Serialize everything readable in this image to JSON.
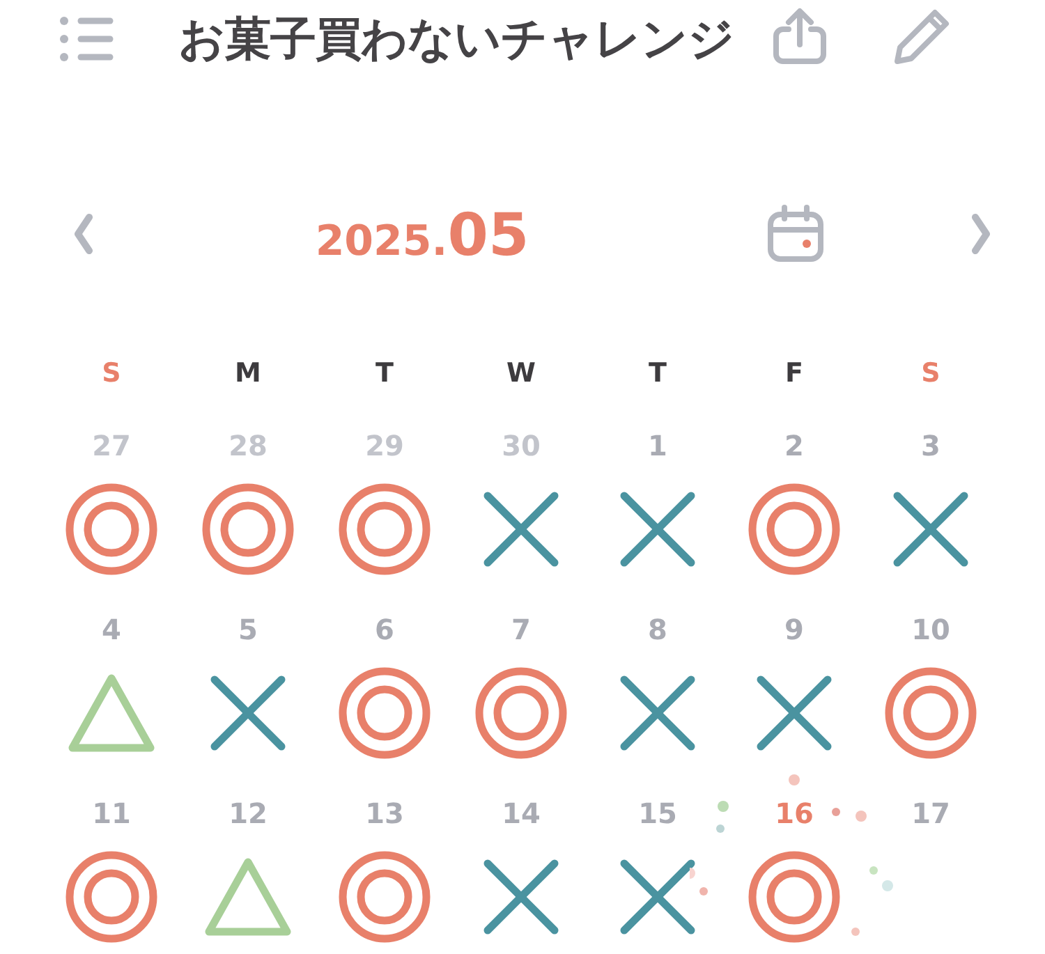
{
  "header": {
    "title": "お菓子買わないチャレンジ"
  },
  "month": {
    "year": "2025.",
    "month": "05"
  },
  "weekdays": [
    {
      "label": "S",
      "weekend": true
    },
    {
      "label": "M",
      "weekend": false
    },
    {
      "label": "T",
      "weekend": false
    },
    {
      "label": "W",
      "weekend": false
    },
    {
      "label": "T",
      "weekend": false
    },
    {
      "label": "F",
      "weekend": false
    },
    {
      "label": "S",
      "weekend": true
    }
  ],
  "days": [
    {
      "number": "27",
      "muted": true,
      "today": false,
      "kind": "circle"
    },
    {
      "number": "28",
      "muted": true,
      "today": false,
      "kind": "circle"
    },
    {
      "number": "29",
      "muted": true,
      "today": false,
      "kind": "circle"
    },
    {
      "number": "30",
      "muted": true,
      "today": false,
      "kind": "cross"
    },
    {
      "number": "1",
      "muted": false,
      "today": false,
      "kind": "cross"
    },
    {
      "number": "2",
      "muted": false,
      "today": false,
      "kind": "circle"
    },
    {
      "number": "3",
      "muted": false,
      "today": false,
      "kind": "cross"
    },
    {
      "number": "4",
      "muted": false,
      "today": false,
      "kind": "triangle"
    },
    {
      "number": "5",
      "muted": false,
      "today": false,
      "kind": "cross"
    },
    {
      "number": "6",
      "muted": false,
      "today": false,
      "kind": "circle"
    },
    {
      "number": "7",
      "muted": false,
      "today": false,
      "kind": "circle"
    },
    {
      "number": "8",
      "muted": false,
      "today": false,
      "kind": "cross"
    },
    {
      "number": "9",
      "muted": false,
      "today": false,
      "kind": "cross"
    },
    {
      "number": "10",
      "muted": false,
      "today": false,
      "kind": "circle"
    },
    {
      "number": "11",
      "muted": false,
      "today": false,
      "kind": "circle"
    },
    {
      "number": "12",
      "muted": false,
      "today": false,
      "kind": "triangle"
    },
    {
      "number": "13",
      "muted": false,
      "today": false,
      "kind": "circle"
    },
    {
      "number": "14",
      "muted": false,
      "today": false,
      "kind": "cross"
    },
    {
      "number": "15",
      "muted": false,
      "today": false,
      "kind": "cross"
    },
    {
      "number": "16",
      "muted": false,
      "today": true,
      "kind": "circle"
    },
    {
      "number": "17",
      "muted": false,
      "today": false
    }
  ]
}
